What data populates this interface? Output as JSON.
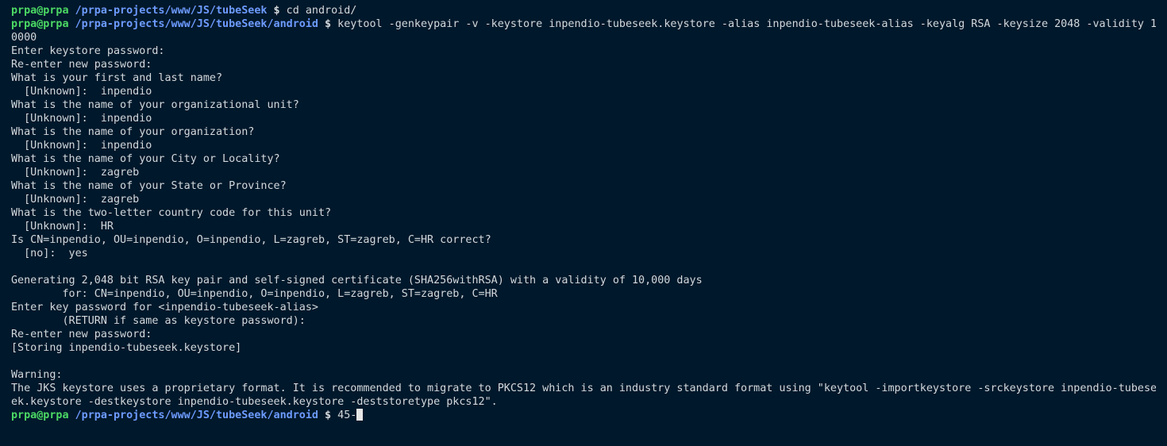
{
  "terminal": {
    "prompt": {
      "user_host": "prpa@prpa",
      "path_root": "/prpa-projects/www/JS/tubeSeek",
      "path_android": "/prpa-projects/www/JS/tubeSeek/android",
      "symbol": "$"
    },
    "lines": [
      {
        "kind": "prompt",
        "path": "/prpa-projects/www/JS/tubeSeek",
        "cmd": "cd android/"
      },
      {
        "kind": "prompt",
        "path": "/prpa-projects/www/JS/tubeSeek/android",
        "cmd": "keytool -genkeypair -v -keystore inpendio-tubeseek.keystore -alias inpendio-tubeseek-alias -keyalg RSA -keysize 2048 -validity 1"
      },
      {
        "kind": "text",
        "text": "0000"
      },
      {
        "kind": "text",
        "text": "Enter keystore password:"
      },
      {
        "kind": "text",
        "text": "Re-enter new password:"
      },
      {
        "kind": "text",
        "text": "What is your first and last name?"
      },
      {
        "kind": "text",
        "text": "  [Unknown]:  inpendio"
      },
      {
        "kind": "text",
        "text": "What is the name of your organizational unit?"
      },
      {
        "kind": "text",
        "text": "  [Unknown]:  inpendio"
      },
      {
        "kind": "text",
        "text": "What is the name of your organization?"
      },
      {
        "kind": "text",
        "text": "  [Unknown]:  inpendio"
      },
      {
        "kind": "text",
        "text": "What is the name of your City or Locality?"
      },
      {
        "kind": "text",
        "text": "  [Unknown]:  zagreb"
      },
      {
        "kind": "text",
        "text": "What is the name of your State or Province?"
      },
      {
        "kind": "text",
        "text": "  [Unknown]:  zagreb"
      },
      {
        "kind": "text",
        "text": "What is the two-letter country code for this unit?"
      },
      {
        "kind": "text",
        "text": "  [Unknown]:  HR"
      },
      {
        "kind": "text",
        "text": "Is CN=inpendio, OU=inpendio, O=inpendio, L=zagreb, ST=zagreb, C=HR correct?"
      },
      {
        "kind": "text",
        "text": "  [no]:  yes"
      },
      {
        "kind": "text",
        "text": ""
      },
      {
        "kind": "text",
        "text": "Generating 2,048 bit RSA key pair and self-signed certificate (SHA256withRSA) with a validity of 10,000 days"
      },
      {
        "kind": "text",
        "text": "        for: CN=inpendio, OU=inpendio, O=inpendio, L=zagreb, ST=zagreb, C=HR"
      },
      {
        "kind": "text",
        "text": "Enter key password for <inpendio-tubeseek-alias>"
      },
      {
        "kind": "text",
        "text": "        (RETURN if same as keystore password):"
      },
      {
        "kind": "text",
        "text": "Re-enter new password:"
      },
      {
        "kind": "text",
        "text": "[Storing inpendio-tubeseek.keystore]"
      },
      {
        "kind": "text",
        "text": ""
      },
      {
        "kind": "text",
        "text": "Warning:"
      },
      {
        "kind": "text",
        "text": "The JKS keystore uses a proprietary format. It is recommended to migrate to PKCS12 which is an industry standard format using \"keytool -importkeystore -srckeystore inpendio-tubese"
      },
      {
        "kind": "text",
        "text": "ek.keystore -destkeystore inpendio-tubeseek.keystore -deststoretype pkcs12\"."
      },
      {
        "kind": "prompt",
        "path": "/prpa-projects/www/JS/tubeSeek/android",
        "cmd": "45-",
        "cursor": true
      }
    ]
  },
  "colors": {
    "background": "#00182b",
    "text": "#d4d8dc",
    "user_host": "#4cd964",
    "path": "#6e9bff"
  }
}
